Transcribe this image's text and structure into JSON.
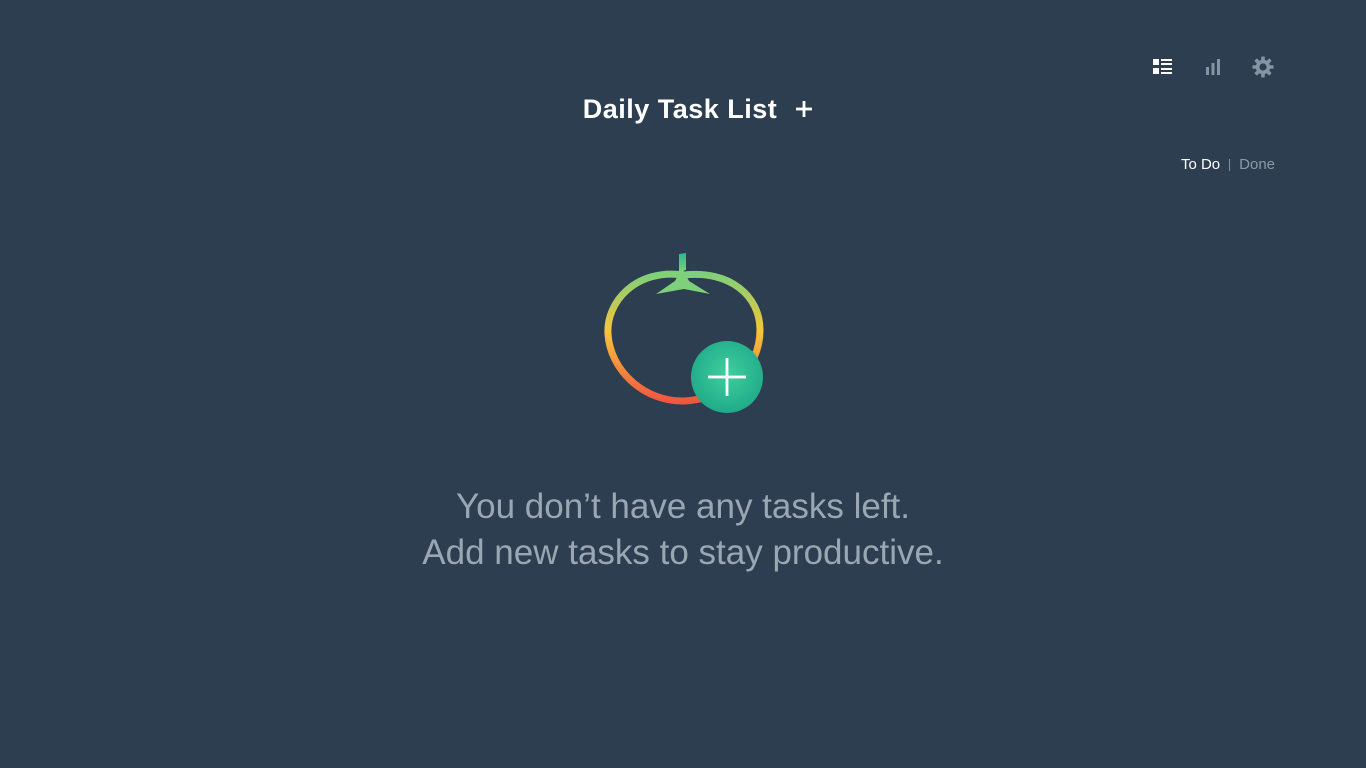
{
  "toolbar": {
    "icons": [
      "task-list-icon",
      "statistics-icon",
      "settings-icon"
    ]
  },
  "header": {
    "title": "Daily Task List",
    "add_symbol": "+"
  },
  "filter": {
    "todo_label": "To Do",
    "done_label": "Done",
    "active": "To Do"
  },
  "empty_state": {
    "line1": "You don’t have any tasks left.",
    "line2": "Add new tasks to stay productive."
  },
  "colors": {
    "background": "#2c3e4f",
    "accent_green": "#2bb895",
    "tomato_top": "#7ed07a",
    "tomato_mid": "#f7c63a",
    "tomato_bottom": "#f0573f",
    "muted_text": "#9aa7b3"
  }
}
